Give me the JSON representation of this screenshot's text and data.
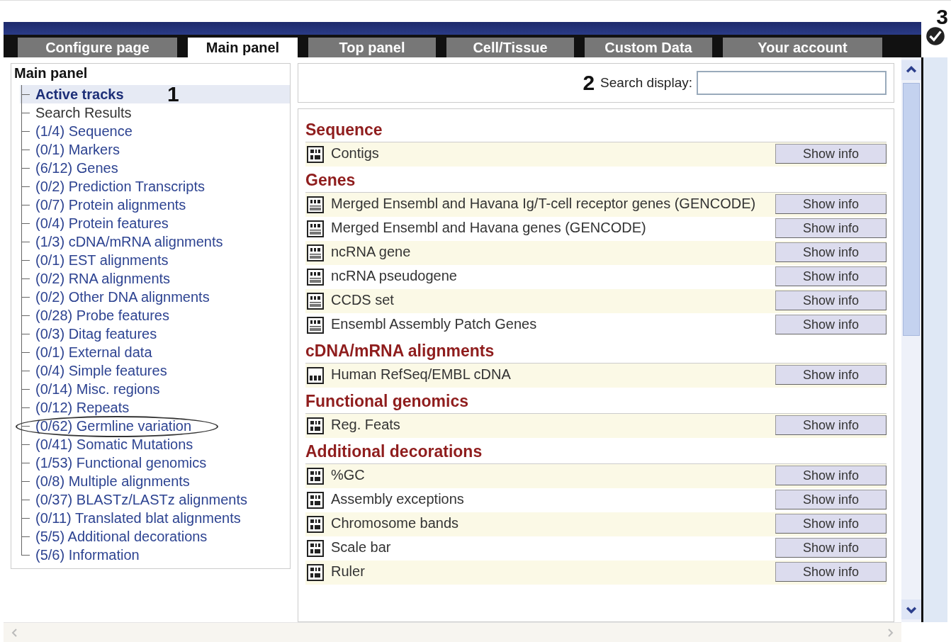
{
  "tabs": [
    {
      "label": "Configure page",
      "selected": false
    },
    {
      "label": "Main panel",
      "selected": true
    },
    {
      "label": "Top panel",
      "selected": false
    },
    {
      "label": "Cell/Tissue",
      "selected": false
    },
    {
      "label": "Custom Data",
      "selected": false
    },
    {
      "label": "Your account",
      "selected": false
    }
  ],
  "done_callout": "3",
  "sidebar": {
    "title": "Main panel",
    "items": [
      {
        "label": "Active tracks",
        "kind": "link",
        "selected": true,
        "callout": "1"
      },
      {
        "label": "Search Results",
        "kind": "text",
        "selected": false
      },
      {
        "label": "(1/4) Sequence",
        "kind": "link",
        "selected": false
      },
      {
        "label": "(0/1) Markers",
        "kind": "link",
        "selected": false
      },
      {
        "label": "(6/12) Genes",
        "kind": "link",
        "selected": false
      },
      {
        "label": "(0/2) Prediction Transcripts",
        "kind": "link",
        "selected": false
      },
      {
        "label": "(0/7) Protein alignments",
        "kind": "link",
        "selected": false
      },
      {
        "label": "(0/4) Protein features",
        "kind": "link",
        "selected": false
      },
      {
        "label": "(1/3) cDNA/mRNA alignments",
        "kind": "link",
        "selected": false
      },
      {
        "label": "(0/1) EST alignments",
        "kind": "link",
        "selected": false
      },
      {
        "label": "(0/2) RNA alignments",
        "kind": "link",
        "selected": false
      },
      {
        "label": "(0/2) Other DNA alignments",
        "kind": "link",
        "selected": false
      },
      {
        "label": "(0/28) Probe features",
        "kind": "link",
        "selected": false
      },
      {
        "label": "(0/3) Ditag features",
        "kind": "link",
        "selected": false
      },
      {
        "label": "(0/1) External data",
        "kind": "link",
        "selected": false
      },
      {
        "label": "(0/4) Simple features",
        "kind": "link",
        "selected": false
      },
      {
        "label": "(0/14) Misc. regions",
        "kind": "link",
        "selected": false
      },
      {
        "label": "(0/12) Repeats",
        "kind": "link",
        "selected": false
      },
      {
        "label": "(0/62) Germline variation",
        "kind": "link",
        "selected": false,
        "circled": true
      },
      {
        "label": "(0/41) Somatic Mutations",
        "kind": "link",
        "selected": false
      },
      {
        "label": "(1/53) Functional genomics",
        "kind": "link",
        "selected": false
      },
      {
        "label": "(0/8) Multiple alignments",
        "kind": "link",
        "selected": false
      },
      {
        "label": "(0/37) BLASTz/LASTz alignments",
        "kind": "link",
        "selected": false
      },
      {
        "label": "(0/11) Translated blat alignments",
        "kind": "link",
        "selected": false
      },
      {
        "label": "(5/5) Additional decorations",
        "kind": "link",
        "selected": false
      },
      {
        "label": "(5/6) Information",
        "kind": "link",
        "selected": false
      }
    ]
  },
  "search": {
    "callout": "2",
    "label": "Search display:"
  },
  "sections": [
    {
      "heading": "Sequence",
      "tracks": [
        {
          "label": "Contigs",
          "kind": "block",
          "button": "Show info"
        }
      ]
    },
    {
      "heading": "Genes",
      "tracks": [
        {
          "label": "Merged Ensembl and Havana Ig/T-cell receptor genes (GENCODE)",
          "kind": "gene",
          "button": "Show info"
        },
        {
          "label": "Merged Ensembl and Havana genes (GENCODE)",
          "kind": "gene",
          "button": "Show info"
        },
        {
          "label": "ncRNA gene",
          "kind": "gene",
          "button": "Show info"
        },
        {
          "label": "ncRNA pseudogene",
          "kind": "gene",
          "button": "Show info"
        },
        {
          "label": "CCDS set",
          "kind": "gene",
          "button": "Show info"
        },
        {
          "label": "Ensembl Assembly Patch Genes",
          "kind": "gene",
          "button": "Show info"
        }
      ]
    },
    {
      "heading": "cDNA/mRNA alignments",
      "tracks": [
        {
          "label": "Human RefSeq/EMBL cDNA",
          "kind": "align",
          "button": "Show info"
        }
      ]
    },
    {
      "heading": "Functional genomics",
      "tracks": [
        {
          "label": "Reg. Feats",
          "kind": "block",
          "button": "Show info"
        }
      ]
    },
    {
      "heading": "Additional decorations",
      "tracks": [
        {
          "label": "%GC",
          "kind": "block",
          "button": "Show info"
        },
        {
          "label": "Assembly exceptions",
          "kind": "block",
          "button": "Show info"
        },
        {
          "label": "Chromosome bands",
          "kind": "block",
          "button": "Show info"
        },
        {
          "label": "Scale bar",
          "kind": "block",
          "button": "Show info"
        },
        {
          "label": "Ruler",
          "kind": "block",
          "button": "Show info"
        }
      ]
    }
  ]
}
